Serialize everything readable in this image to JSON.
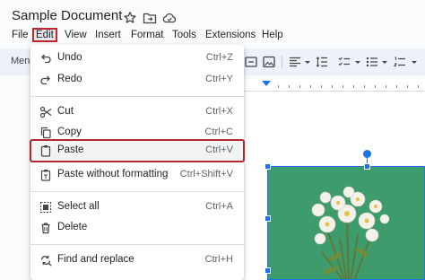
{
  "document": {
    "title": "Sample Document"
  },
  "title_icons": [
    "star-icon",
    "move-to-folder-icon",
    "cloud-saved-icon"
  ],
  "menubar": {
    "items": [
      "File",
      "Edit",
      "View",
      "Insert",
      "Format",
      "Tools",
      "Extensions",
      "Help"
    ],
    "active": "Edit"
  },
  "toolbar": {
    "menus_label": "Menu"
  },
  "edit_menu": {
    "items": [
      {
        "label": "Undo",
        "shortcut": "Ctrl+Z",
        "icon": "undo-icon"
      },
      {
        "label": "Redo",
        "shortcut": "Ctrl+Y",
        "icon": "redo-icon"
      },
      {
        "label": "Cut",
        "shortcut": "Ctrl+X",
        "icon": "scissors-icon"
      },
      {
        "label": "Copy",
        "shortcut": "Ctrl+C",
        "icon": "copy-icon"
      },
      {
        "label": "Paste",
        "shortcut": "Ctrl+V",
        "icon": "clipboard-icon"
      },
      {
        "label": "Paste without formatting",
        "shortcut": "Ctrl+Shift+V",
        "icon": "clipboard-plain-icon"
      },
      {
        "label": "Select all",
        "shortcut": "Ctrl+A",
        "icon": "select-all-icon"
      },
      {
        "label": "Delete",
        "shortcut": "",
        "icon": "trash-icon"
      },
      {
        "label": "Find and replace",
        "shortcut": "Ctrl+H",
        "icon": "find-replace-icon"
      }
    ],
    "highlighted": "Paste"
  },
  "colors": {
    "highlight_border": "#b3262e",
    "selection_blue": "#1a73e8",
    "image_background": "#3d9b6c"
  }
}
